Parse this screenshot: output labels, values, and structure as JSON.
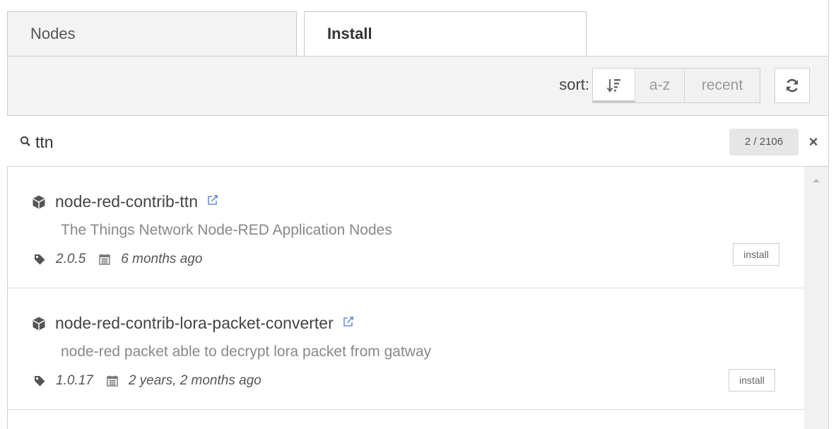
{
  "tabs": [
    {
      "label": "Nodes"
    },
    {
      "label": "Install"
    }
  ],
  "toolbar": {
    "sort_label": "sort:",
    "sort_options": [
      {
        "label": "",
        "icon": "sort-relevance-icon",
        "active": true
      },
      {
        "label": "a-z",
        "active": false
      },
      {
        "label": "recent",
        "active": false
      }
    ],
    "refresh_icon": "refresh-icon"
  },
  "search": {
    "value": "ttn",
    "count": "2 / 2106",
    "clear_label": "×"
  },
  "results": [
    {
      "name": "node-red-contrib-ttn",
      "description": "The Things Network Node-RED Application Nodes",
      "version": "2.0.5",
      "updated": "6 months ago",
      "install_label": "install"
    },
    {
      "name": "node-red-contrib-lora-packet-converter",
      "description": "node-red packet able to decrypt lora packet from gatway",
      "version": "1.0.17",
      "updated": "2 years, 2 months ago",
      "install_label": "install"
    }
  ],
  "colors": {
    "toolbar_bg": "#f3f3f3",
    "border": "#d0d0d0",
    "link_icon": "#6a8fd6"
  }
}
